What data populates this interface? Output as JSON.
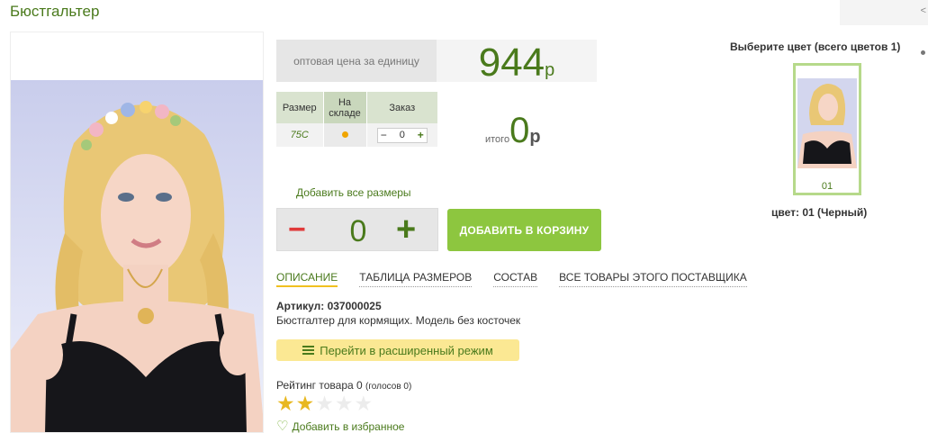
{
  "product": {
    "title": "Бюстгальтер",
    "corner_char": "<"
  },
  "price": {
    "label": "оптовая цена за единицу",
    "value": "944",
    "currency": "р"
  },
  "size_table": {
    "headers": [
      "Размер",
      "На складе",
      "Заказ"
    ],
    "rows": [
      {
        "size": "75C",
        "qty": "0"
      }
    ],
    "stock_color": "#f0a500"
  },
  "total": {
    "label": "итого",
    "value": "0",
    "currency": "р"
  },
  "order": {
    "add_all_label": "Добавить все размеры",
    "quantity": "0",
    "minus": "−",
    "plus": "+",
    "cart_button": "ДОБАВИТЬ В КОРЗИНУ"
  },
  "tabs": [
    "ОПИСАНИЕ",
    "ТАБЛИЦА РАЗМЕРОВ",
    "СОСТАВ",
    "ВСЕ ТОВАРЫ ЭТОГО ПОСТАВЩИКА"
  ],
  "description": {
    "article": "Артикул: 037000025",
    "text": "Бюстгалтер для кормящих. Модель без косточек"
  },
  "extended_mode": {
    "label": "Перейти в расширенный режим",
    "icon": "list-icon"
  },
  "rating": {
    "label": "Рейтинг товара 0",
    "votes": "(голосов 0)",
    "stars_filled": 2,
    "stars_total": 5
  },
  "favorite": {
    "label": "Добавить в избранное",
    "icon": "heart-icon"
  },
  "colors": {
    "title": "Выберите цвет (всего цветов 1)",
    "swatch_label": "01",
    "selected": "цвет: 01 (Черный)"
  },
  "theme": {
    "accent": "#4a7a1c",
    "button_green": "#8dc63f",
    "minus_red": "#e03a3a",
    "star_gold": "#e8b820",
    "extended_bg": "#fbe893"
  }
}
